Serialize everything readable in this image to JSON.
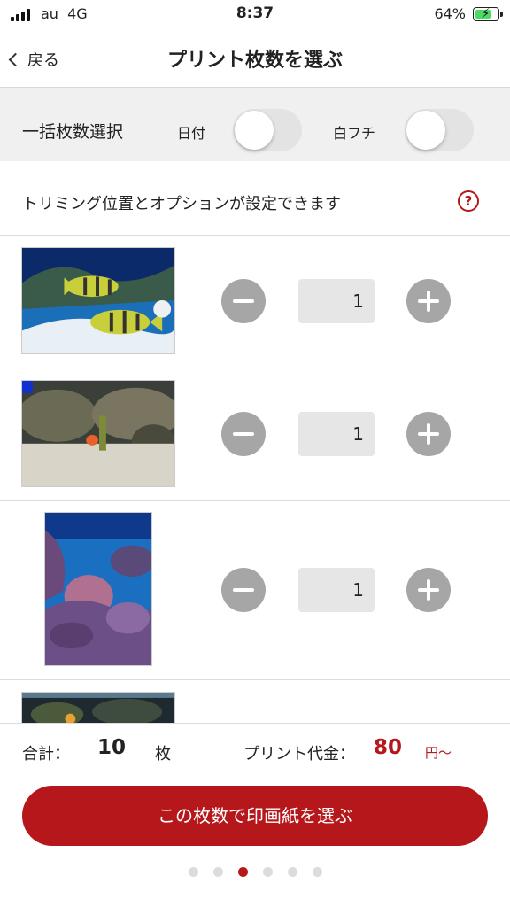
{
  "status": {
    "carrier": "au",
    "network": "4G",
    "time": "8:37",
    "battery": "64%",
    "battery_level": 0.64
  },
  "nav": {
    "back_label": "戻る",
    "title": "プリント枚数を選ぶ"
  },
  "bulk": {
    "label": "一括枚数選択",
    "date_label": "日付",
    "date_on": false,
    "border_label": "白フチ",
    "border_on": false
  },
  "info": {
    "text": "トリミング位置とオプションが設定できます",
    "help_glyph": "?"
  },
  "photos": [
    {
      "quantity": "1"
    },
    {
      "quantity": "1"
    },
    {
      "quantity": "1"
    }
  ],
  "summary": {
    "total_label": "合計：",
    "total_count": "10",
    "total_unit": "枚",
    "price_label": "プリント代金：",
    "price_value": "80",
    "price_unit": "円〜"
  },
  "cta_label": "この枚数で印画紙を選ぶ",
  "pager": {
    "count": 6,
    "active_index": 2
  },
  "colors": {
    "accent": "#b5171b",
    "button_gray": "#a6a6a6"
  }
}
